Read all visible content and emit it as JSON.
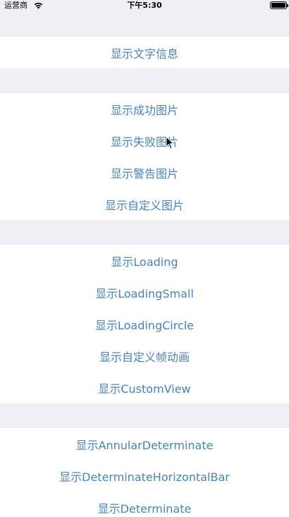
{
  "status_bar": {
    "carrier": "运营商",
    "time": "下午5:30",
    "battery_level": 1.0
  },
  "sections": [
    {
      "rows": [
        "显示文字信息"
      ]
    },
    {
      "rows": [
        "显示成功图片",
        "显示失败图片",
        "显示警告图片",
        "显示自定义图片"
      ]
    },
    {
      "rows": [
        "显示Loading",
        "显示LoadingSmall",
        "显示LoadingCircle",
        "显示自定义帧动画",
        "显示CustomView"
      ]
    },
    {
      "rows": [
        "显示AnnularDeterminate",
        "显示DeterminateHorizontalBar",
        "显示Determinate"
      ]
    }
  ],
  "colors": {
    "background": "#efeff4",
    "cell": "#ffffff",
    "tint": "#4a82b0"
  },
  "icons": {
    "wifi": "wifi-icon",
    "battery": "battery-icon",
    "cursor": "mouse-pointer-icon"
  }
}
